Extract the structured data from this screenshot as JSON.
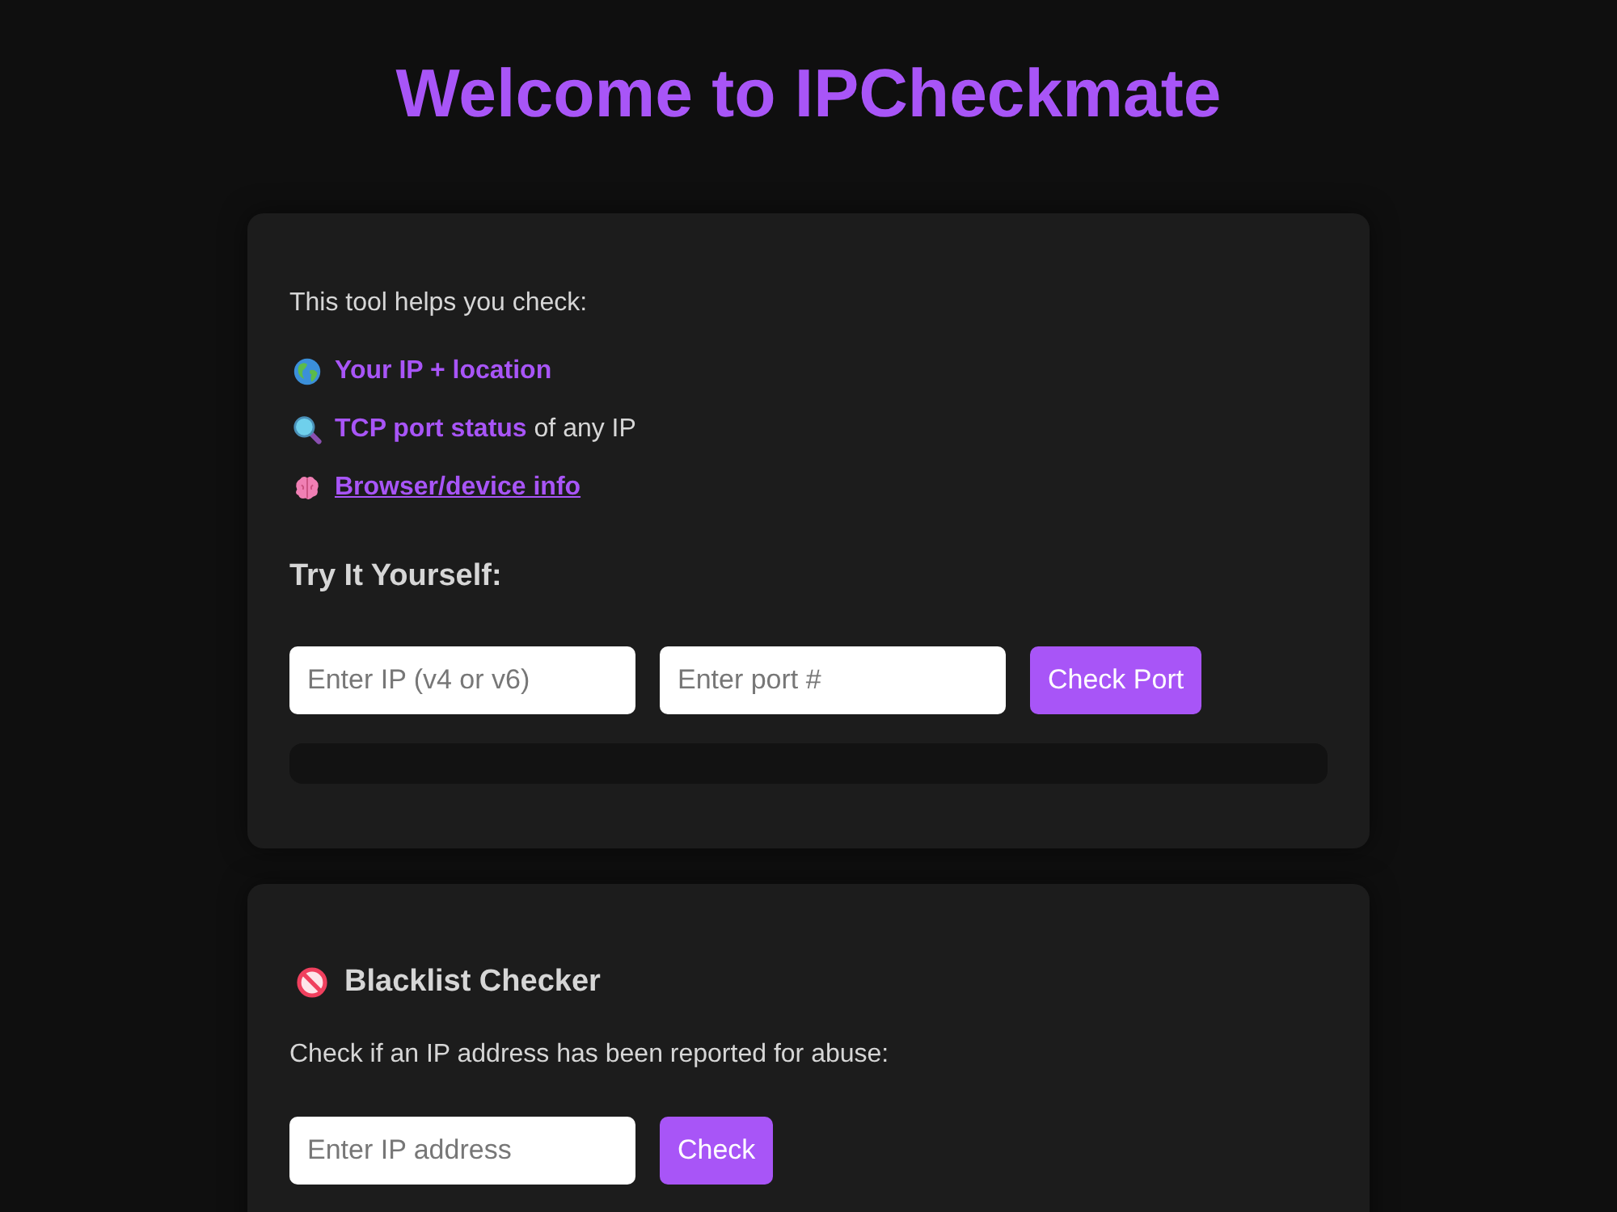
{
  "header": {
    "title": "Welcome to IPCheckmate"
  },
  "intro_card": {
    "lead": "This tool helps you check:",
    "features": [
      {
        "kind": "highlight",
        "text": "Your IP + location"
      },
      {
        "kind": "mixed",
        "text": "**TCP port status** of any IP"
      },
      {
        "kind": "link",
        "text": "Browser/device info"
      }
    ],
    "section_title": "Try It Yourself:",
    "fields": [
      {
        "placeholder": "Enter IP (v4 or v6)"
      },
      {
        "placeholder": "Enter port #"
      }
    ],
    "button": "Check Port"
  },
  "blacklist_card": {
    "title": "Blacklist Checker",
    "description": "Check if an IP address has been reported for abuse:",
    "fields": [
      {
        "placeholder": "Enter IP address"
      }
    ],
    "button": "Check"
  }
}
